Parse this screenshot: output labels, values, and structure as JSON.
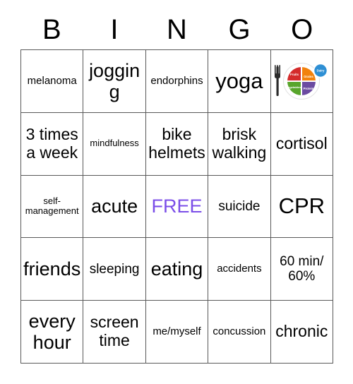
{
  "card": {
    "title": "BINGO",
    "header_letters": [
      "B",
      "I",
      "N",
      "G",
      "O"
    ],
    "free_color": "#7b4ee8",
    "grid_line_color": "#595959",
    "rows": [
      [
        {
          "text": "melanoma",
          "size": "sm",
          "kind": "text"
        },
        {
          "text": "jogging",
          "size": "xl",
          "kind": "text"
        },
        {
          "text": "endorphins",
          "size": "sm",
          "kind": "text"
        },
        {
          "text": "yoga",
          "size": "xxl",
          "kind": "text"
        },
        {
          "text": "MyPlate",
          "size": "sm",
          "kind": "icon",
          "icon": "myplate-icon"
        }
      ],
      [
        {
          "text": "3 times a week",
          "size": "lg",
          "kind": "text"
        },
        {
          "text": "mindfulness",
          "size": "xs",
          "kind": "text"
        },
        {
          "text": "bike helmets",
          "size": "lg",
          "kind": "text"
        },
        {
          "text": "brisk walking",
          "size": "lg",
          "kind": "text"
        },
        {
          "text": "cortisol",
          "size": "lg",
          "kind": "text"
        }
      ],
      [
        {
          "text": "self-management",
          "size": "xs",
          "kind": "text"
        },
        {
          "text": "acute",
          "size": "xl",
          "kind": "text"
        },
        {
          "text": "FREE",
          "size": "xl",
          "kind": "free"
        },
        {
          "text": "suicide",
          "size": "md",
          "kind": "text"
        },
        {
          "text": "CPR",
          "size": "xxl",
          "kind": "text"
        }
      ],
      [
        {
          "text": "friends",
          "size": "xl",
          "kind": "text"
        },
        {
          "text": "sleeping",
          "size": "md",
          "kind": "text"
        },
        {
          "text": "eating",
          "size": "xl",
          "kind": "text"
        },
        {
          "text": "accidents",
          "size": "sm",
          "kind": "text"
        },
        {
          "text": "60 min/ 60%",
          "size": "md",
          "kind": "text"
        }
      ],
      [
        {
          "text": "every hour",
          "size": "xl",
          "kind": "text"
        },
        {
          "text": "screen time",
          "size": "lg",
          "kind": "text"
        },
        {
          "text": "me/myself",
          "size": "sm",
          "kind": "text"
        },
        {
          "text": "concussion",
          "size": "sm",
          "kind": "text"
        },
        {
          "text": "chronic",
          "size": "lg",
          "kind": "text"
        }
      ]
    ]
  },
  "myplate": {
    "label": "MyPlate",
    "segments": [
      {
        "name": "Fruits",
        "color": "#d42b2b"
      },
      {
        "name": "Grains",
        "color": "#f2820d"
      },
      {
        "name": "Vegetables",
        "color": "#58a52b"
      },
      {
        "name": "Protein",
        "color": "#6b4ba1"
      },
      {
        "name": "Dairy",
        "color": "#2e8fd4"
      }
    ],
    "fork_color": "#2b2b2b",
    "plate_rim_color": "#ffffff"
  }
}
